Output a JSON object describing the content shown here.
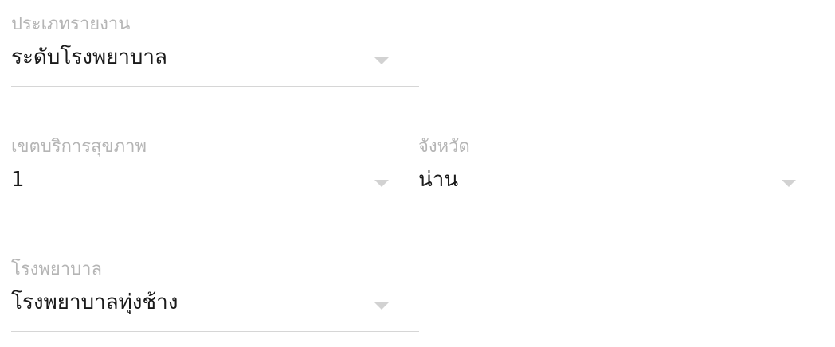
{
  "report_type": {
    "label": "ประเภทรายงาน",
    "value": "ระดับโรงพยาบาล"
  },
  "health_region": {
    "label": "เขตบริการสุขภาพ",
    "value": "1"
  },
  "province": {
    "label": "จังหวัด",
    "value": "น่าน"
  },
  "hospital": {
    "label": "โรงพยาบาล",
    "value": "โรงพยาบาลทุ่งช้าง"
  },
  "colors": {
    "label_text": "#b5b5b5",
    "value_text": "#1a1a1a",
    "underline": "#d6d6d6",
    "caret": "#d2d2d2"
  },
  "icons": [
    "dropdown-caret-icon"
  ]
}
